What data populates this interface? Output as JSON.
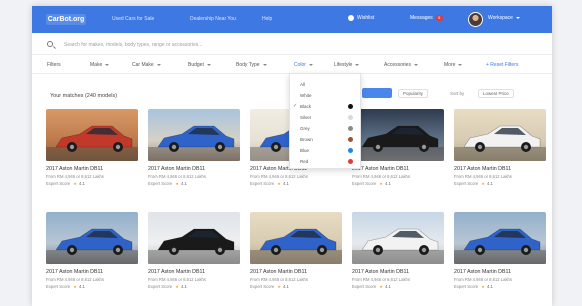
{
  "header": {
    "logo": "CarBot.org",
    "nav": [
      "Used Cars for Sale",
      "Dealership Near You",
      "Help"
    ],
    "notifications_label": "Wishlist",
    "messages_label": "Messages",
    "messages_count": "5",
    "user_label": "Workspace"
  },
  "search": {
    "placeholder": "Search for makes, models, body types, range or accessories..."
  },
  "filters": {
    "items": [
      {
        "label": "Filters"
      },
      {
        "label": "Make"
      },
      {
        "label": "Car Make"
      },
      {
        "label": "Budget"
      },
      {
        "label": "Body Type"
      },
      {
        "label": "Color"
      },
      {
        "label": "Lifestyle"
      },
      {
        "label": "Accessories"
      },
      {
        "label": "More"
      }
    ],
    "reset_label": "+ Reset Filters"
  },
  "results": {
    "count_text": "Your matches (240 models)",
    "view_label": "Grid",
    "sort_options": [
      "Popularity",
      "Lowest Price"
    ],
    "sort_prefix": "Sort by"
  },
  "color_dropdown": {
    "options": [
      {
        "label": "All",
        "swatch": "",
        "checked": false
      },
      {
        "label": "White",
        "swatch": "",
        "checked": false
      },
      {
        "label": "Black",
        "swatch": "#111111",
        "checked": true
      },
      {
        "label": "Silver",
        "swatch": "#d9d9d9",
        "checked": false
      },
      {
        "label": "Grey",
        "swatch": "#8c8c8c",
        "checked": false
      },
      {
        "label": "Brown",
        "swatch": "#a0522d",
        "checked": false
      },
      {
        "label": "Blue",
        "swatch": "#1e88e5",
        "checked": false
      },
      {
        "label": "Red",
        "swatch": "#e53935",
        "checked": false
      }
    ]
  },
  "cars": [
    {
      "title": "2017 Aston Martin DB11",
      "price": "From RM 4,946 or 8,612 Lakhs",
      "rating_label": "Expert Score",
      "rating": "4.1",
      "car_color": "#c0392b"
    },
    {
      "title": "2017 Aston Martin DB11",
      "price": "From RM 4,946 or 8,612 Lakhs",
      "rating_label": "Expert Score",
      "rating": "4.1",
      "car_color": "#2f63c9"
    },
    {
      "title": "2017 Aston Martin DB11",
      "price": "From RM 4,946 or 8,612 Lakhs",
      "rating_label": "Expert Score",
      "rating": "4.1",
      "car_color": "#2f63c9"
    },
    {
      "title": "2017 Aston Martin DB11",
      "price": "From RM 4,946 or 8,612 Lakhs",
      "rating_label": "Expert Score",
      "rating": "4.1",
      "car_color": "#1a1a1a"
    },
    {
      "title": "2017 Aston Martin DB11",
      "price": "From RM 4,946 or 8,612 Lakhs",
      "rating_label": "Expert Score",
      "rating": "4.1",
      "car_color": "#f2f2f2"
    },
    {
      "title": "2017 Aston Martin DB11",
      "price": "From RM 4,946 or 8,612 Lakhs",
      "rating_label": "Expert Score",
      "rating": "4.1",
      "car_color": "#2f63c9"
    },
    {
      "title": "2017 Aston Martin DB11",
      "price": "From RM 4,946 or 8,612 Lakhs",
      "rating_label": "Expert Score",
      "rating": "4.1",
      "car_color": "#1a1a1a"
    },
    {
      "title": "2017 Aston Martin DB11",
      "price": "From RM 4,946 or 8,612 Lakhs",
      "rating_label": "Expert Score",
      "rating": "4.1",
      "car_color": "#2f63c9"
    },
    {
      "title": "2017 Aston Martin DB11",
      "price": "From RM 4,946 or 8,612 Lakhs",
      "rating_label": "Expert Score",
      "rating": "4.1",
      "car_color": "#f2f2f2"
    },
    {
      "title": "2017 Aston Martin DB11",
      "price": "From RM 4,946 or 8,612 Lakhs",
      "rating_label": "Expert Score",
      "rating": "4.1",
      "car_color": "#2f63c9"
    }
  ]
}
